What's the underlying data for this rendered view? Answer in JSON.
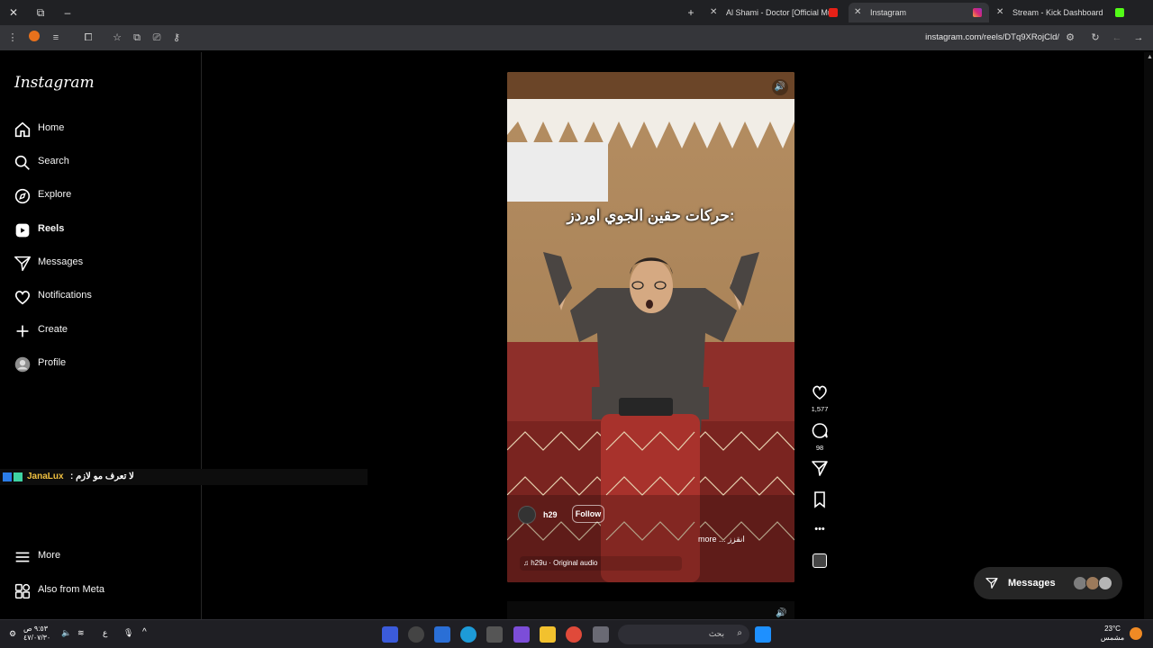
{
  "browser": {
    "tabs": [
      {
        "label": "Al Shami - Doctor [Official Mus",
        "active": false
      },
      {
        "label": "Instagram",
        "active": true
      },
      {
        "label": "Stream - Kick Dashboard",
        "active": false
      }
    ],
    "url": "instagram.com/reels/DTq9XRojCld/"
  },
  "sidebar": {
    "logo": "Instagram",
    "items": [
      {
        "label": "Home",
        "icon": "home-icon"
      },
      {
        "label": "Search",
        "icon": "search-icon"
      },
      {
        "label": "Explore",
        "icon": "compass-icon"
      },
      {
        "label": "Reels",
        "icon": "reels-icon",
        "active": true
      },
      {
        "label": "Messages",
        "icon": "send-icon"
      },
      {
        "label": "Notifications",
        "icon": "heart-icon"
      },
      {
        "label": "Create",
        "icon": "plus-icon"
      },
      {
        "label": "Profile",
        "icon": "avatar-icon"
      }
    ],
    "bottom": [
      {
        "label": "More",
        "icon": "menu-icon"
      },
      {
        "label": "Also from Meta",
        "icon": "meta-icon"
      }
    ]
  },
  "chat_overlay": {
    "username": "JanaLux",
    "message": ": لا تعرف مو لازم"
  },
  "reel": {
    "caption_overlay": "حركات حقين الجوي اوردز:",
    "username": "h29",
    "follow_label": "Follow",
    "description": "more ... انقزز",
    "audio": "h29u · Original audio",
    "likes": "1,577",
    "comments": "98"
  },
  "messages_pill": {
    "label": "Messages"
  },
  "taskbar": {
    "search_placeholder": "بحث",
    "clock_time": "٩:٥٣ ص",
    "clock_date": "٤٧/٠٧/٣٠",
    "temperature": "23°C",
    "weather": "مشمس",
    "lang": "ع"
  },
  "colors": {
    "background": "#000000",
    "sidebar_border": "#262626",
    "accent_chat_user": "#f0c040"
  }
}
